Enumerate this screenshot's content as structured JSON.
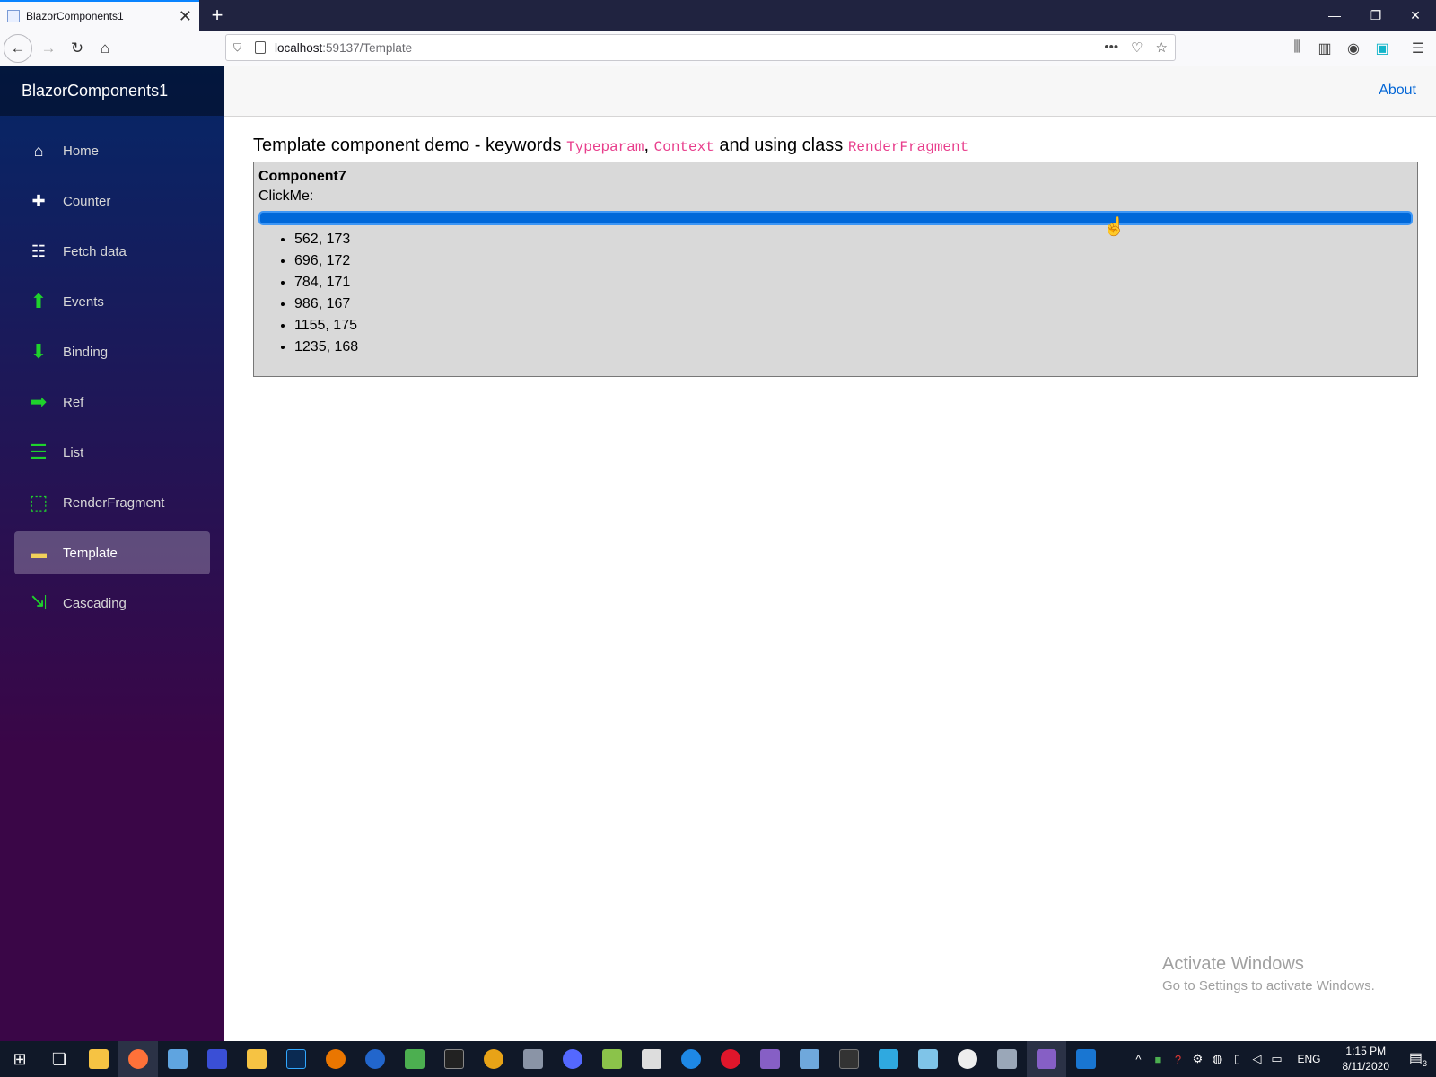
{
  "browser": {
    "tab_title": "BlazorComponents1",
    "tab_close": "✕",
    "new_tab": "+",
    "url_host": "localhost",
    "url_path": ":59137/Template",
    "window_minimize": "—",
    "window_restore": "❐",
    "window_close": "✕"
  },
  "sidebar": {
    "brand": "BlazorComponents1",
    "items": [
      {
        "label": "Home",
        "icon": "home-icon"
      },
      {
        "label": "Counter",
        "icon": "plus-icon"
      },
      {
        "label": "Fetch data",
        "icon": "list-rich-icon"
      },
      {
        "label": "Events",
        "icon": "arrow-up-icon"
      },
      {
        "label": "Binding",
        "icon": "arrow-down-icon"
      },
      {
        "label": "Ref",
        "icon": "arrow-right-icon"
      },
      {
        "label": "List",
        "icon": "list-icon"
      },
      {
        "label": "RenderFragment",
        "icon": "render-fragment-icon"
      },
      {
        "label": "Template",
        "icon": "template-icon"
      },
      {
        "label": "Cascading",
        "icon": "cascading-icon"
      }
    ],
    "active": "Template"
  },
  "topbar": {
    "about": "About"
  },
  "main": {
    "heading_prefix": "Template component demo - keywords ",
    "kw1": "Typeparam",
    "sep": ", ",
    "kw2": "Context",
    "heading_mid": " and using class ",
    "kw3": "RenderFragment",
    "component_title": "Component7",
    "clickme_label": "ClickMe:",
    "points": [
      "562, 173",
      "696, 172",
      "784, 171",
      "986, 167",
      "1155, 175",
      "1235, 168"
    ]
  },
  "watermark": {
    "line1": "Activate Windows",
    "line2": "Go to Settings to activate Windows."
  },
  "taskbar": {
    "lang": "ENG",
    "time": "1:15 PM",
    "date": "8/11/2020",
    "notification_count": "3"
  },
  "colors": {
    "sidebar_top": "#052767",
    "sidebar_bottom": "#3a0647",
    "link": "#0366d6",
    "code": "#e83e8c",
    "click_bar": "#0068d9",
    "icon_green": "#1fd22c"
  }
}
